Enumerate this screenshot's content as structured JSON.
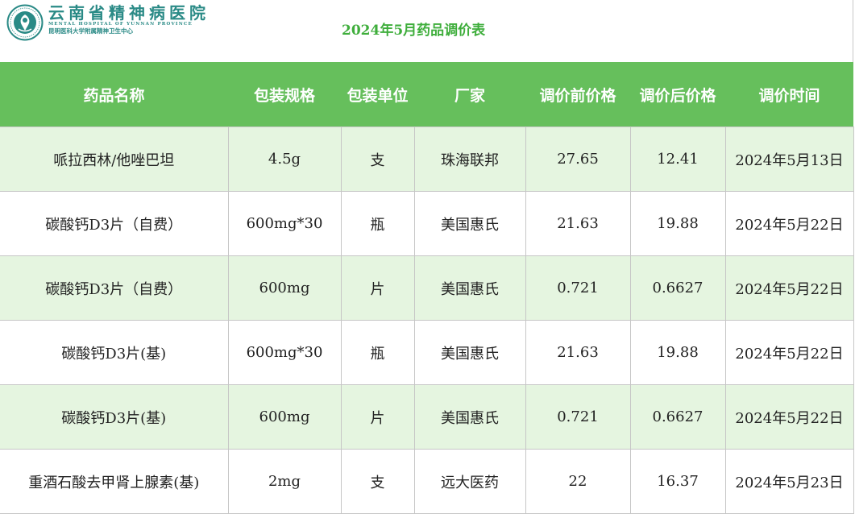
{
  "header": {
    "hospital_name": "云南省精神病医院",
    "hospital_name_en": "MENTAL HOSPITAL OF YUNNAN PROVINCE",
    "hospital_subtitle": "昆明医科大学附属精神卫生中心",
    "title": "2024年5月药品调价表",
    "brand_color": "#2a8a86",
    "title_color": "#3fae3c"
  },
  "table": {
    "header_bg": "#66bf5c",
    "alt_row_bg": "#e5f5e0",
    "columns": [
      "药品名称",
      "包装规格",
      "包装单位",
      "厂家",
      "调价前价格",
      "调价后价格",
      "调价时间"
    ],
    "rows": [
      [
        "哌拉西林/他唑巴坦",
        "4.5g",
        "支",
        "珠海联邦",
        "27.65",
        "12.41",
        "2024年5月13日"
      ],
      [
        "碳酸钙D3片（自费）",
        "600mg*30",
        "瓶",
        "美国惠氏",
        "21.63",
        "19.88",
        "2024年5月22日"
      ],
      [
        "碳酸钙D3片（自费）",
        "600mg",
        "片",
        "美国惠氏",
        "0.721",
        "0.6627",
        "2024年5月22日"
      ],
      [
        "碳酸钙D3片(基)",
        "600mg*30",
        "瓶",
        "美国惠氏",
        "21.63",
        "19.88",
        "2024年5月22日"
      ],
      [
        "碳酸钙D3片(基)",
        "600mg",
        "片",
        "美国惠氏",
        "0.721",
        "0.6627",
        "2024年5月22日"
      ],
      [
        "重酒石酸去甲肾上腺素(基)",
        "2mg",
        "支",
        "远大医药",
        "22",
        "16.37",
        "2024年5月23日"
      ]
    ]
  }
}
